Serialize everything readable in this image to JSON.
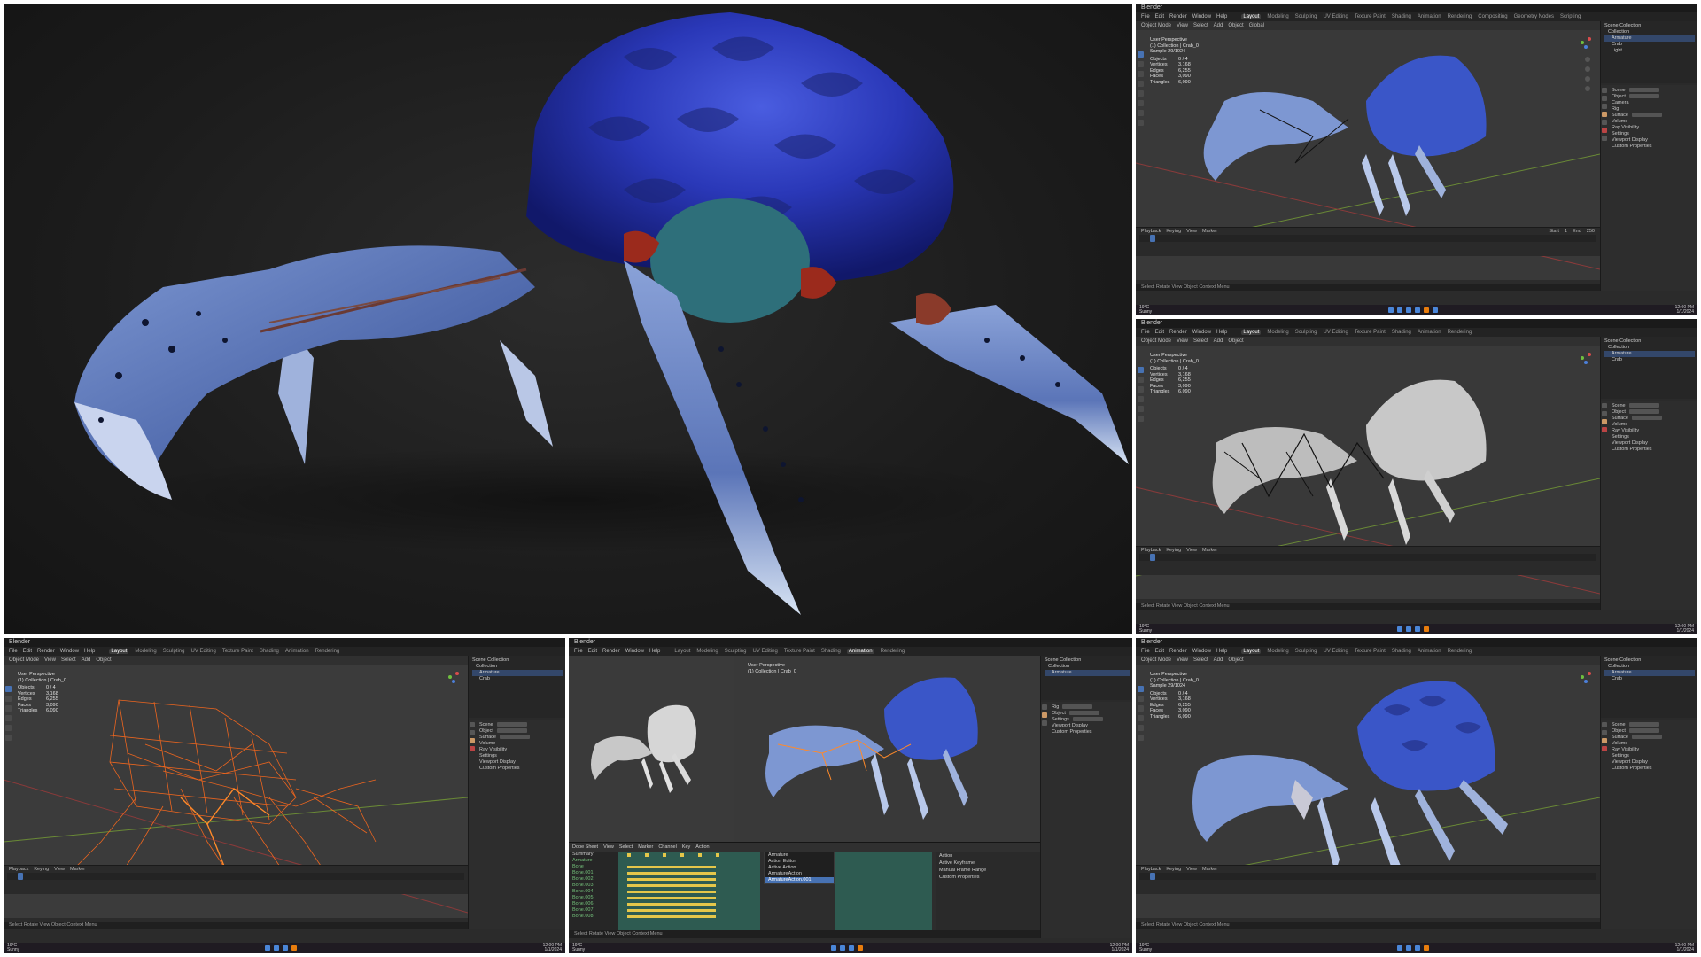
{
  "hero": {
    "alt": "Textured crab creature render"
  },
  "blender": {
    "window_title": "Blender",
    "menu": [
      "File",
      "Edit",
      "Render",
      "Window",
      "Help"
    ],
    "workspaces": [
      "Layout",
      "Modeling",
      "Sculpting",
      "UV Editing",
      "Texture Paint",
      "Shading",
      "Animation",
      "Rendering",
      "Compositing",
      "Geometry Nodes",
      "Scripting"
    ],
    "anim_workspace_active": "Animation",
    "header": {
      "mode": "Object Mode",
      "view": "View",
      "select": "Select",
      "add": "Add",
      "object": "Object",
      "transform": "Global",
      "options": "Options"
    },
    "overlay": {
      "perspective": "User Perspective",
      "collection": "(1) Collection | Crab_0",
      "sample": "Sample 29/1024"
    },
    "stats": [
      {
        "k": "Objects",
        "v": "0 / 4"
      },
      {
        "k": "Vertices",
        "v": "3,168"
      },
      {
        "k": "Edges",
        "v": "6,255"
      },
      {
        "k": "Faces",
        "v": "3,090"
      },
      {
        "k": "Triangles",
        "v": "6,090"
      }
    ],
    "outliner": [
      "Scene Collection",
      "Collection",
      "Armature",
      "Crab",
      "Light"
    ],
    "properties": [
      "Scene",
      "Object",
      "Camera",
      "Rig",
      "Surface",
      "Volume",
      "Ray Visibility",
      "Settings",
      "Viewport Display",
      "Custom Properties"
    ],
    "timeline": {
      "playback": "Playback",
      "keying": "Keying",
      "view": "View",
      "marker": "Marker",
      "start": "Start",
      "start_val": "1",
      "end": "End",
      "end_val": "250"
    },
    "status": "Select    Rotate View    Object Context Menu",
    "taskbar_left": [
      "19°C",
      "Sunny"
    ],
    "taskbar_right": [
      "12:00 PM",
      "1/1/2024"
    ]
  },
  "dopesheet": {
    "header": [
      "Dope Sheet",
      "View",
      "Select",
      "Marker",
      "Channel",
      "Key",
      "Action"
    ],
    "channels": [
      "Summary",
      "Armature",
      "Bone",
      "Bone.001",
      "Bone.002",
      "Bone.003",
      "Bone.004",
      "Bone.005",
      "Bone.006",
      "Bone.007",
      "Bone.008"
    ],
    "menu": [
      "Armature",
      "Action Editor",
      "Active Action",
      "ArmatureAction",
      "ArmatureAction.001"
    ],
    "menu_highlight_index": 4,
    "sidebar": [
      "Action",
      "Active Keyframe",
      "Manual Frame Range",
      "Custom Properties"
    ]
  },
  "colors": {
    "accent": "#4772b3",
    "wire": "#ff6a1c",
    "bone": "#ff8a2a",
    "selected_row": "#33476a"
  }
}
